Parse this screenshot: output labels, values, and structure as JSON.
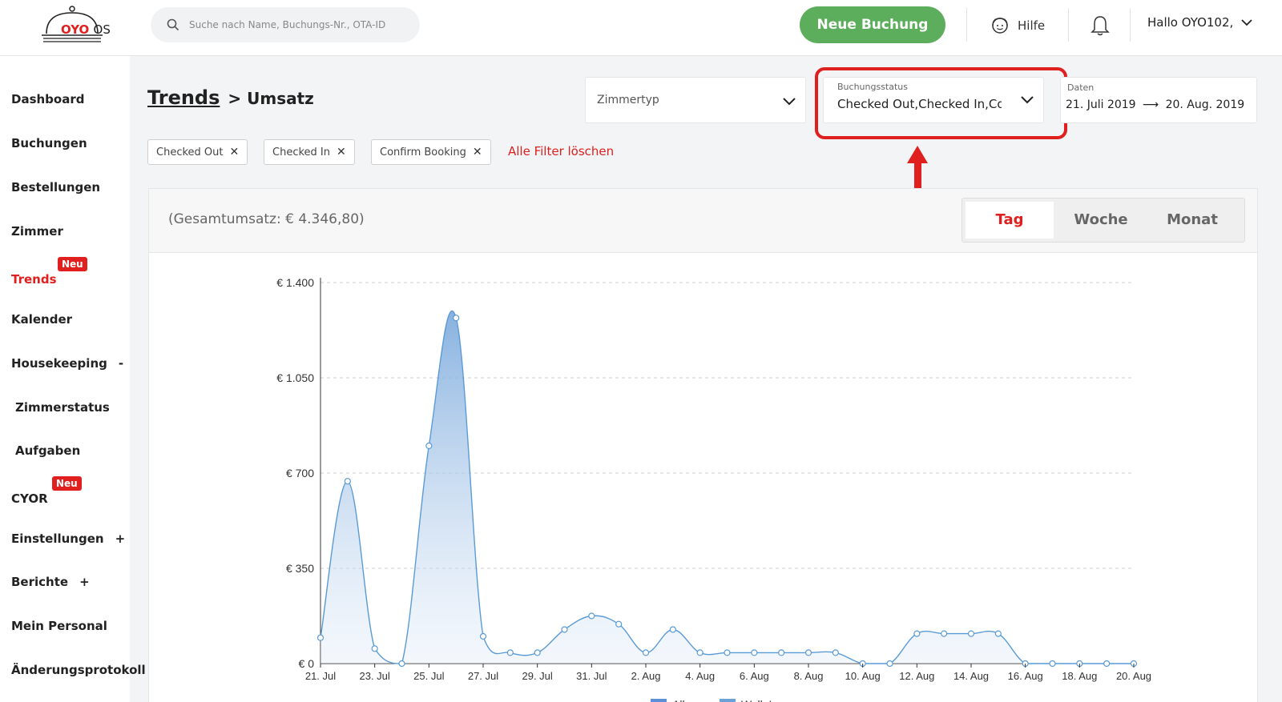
{
  "header": {
    "logo": {
      "brand": "OYO",
      "suffix": "OS"
    },
    "search": {
      "placeholder": "Suche nach Name, Buchungs-Nr., OTA-ID"
    },
    "new_booking": "Neue Buchung",
    "help": "Hilfe",
    "user_greeting": "Hallo OYO102,"
  },
  "sidebar": {
    "items": [
      {
        "label": "Dashboard"
      },
      {
        "label": "Buchungen"
      },
      {
        "label": "Bestellungen"
      },
      {
        "label": "Zimmer"
      },
      {
        "label": "Trends",
        "badge": "Neu",
        "active": true
      },
      {
        "label": "Kalender"
      },
      {
        "label": "Housekeeping",
        "suffix": "-"
      },
      {
        "label": "Zimmerstatus",
        "sub": true
      },
      {
        "label": "Aufgaben",
        "sub": true
      },
      {
        "label": "CYOR",
        "badge": "Neu"
      },
      {
        "label": "Einstellungen",
        "suffix": "+"
      },
      {
        "label": "Berichte",
        "suffix": "+"
      },
      {
        "label": "Mein Personal"
      },
      {
        "label": "Änderungsprotokoll"
      }
    ]
  },
  "main": {
    "breadcrumb_link": "Trends",
    "breadcrumb_current": "> Umsatz",
    "room_type": {
      "value": "Zimmertyp"
    },
    "booking_status": {
      "label": "Buchungsstatus",
      "value": "Checked Out,Checked In,Confirm Booking"
    },
    "dates": {
      "label": "Daten",
      "from": "21. Juli 2019",
      "arrow": "⟶",
      "to": "20. Aug. 2019"
    },
    "chips": [
      "Checked Out",
      "Checked In",
      "Confirm Booking"
    ],
    "chip_close": "✕",
    "clear_all": "Alle Filter löschen",
    "total": "(Gesamtumsatz: € 4.346,80)",
    "tabs": [
      "Tag",
      "Woche",
      "Monat"
    ],
    "active_tab": "Tag"
  },
  "colors": {
    "accent": "#e0201e",
    "primary_button": "#5cae5c",
    "series_line": "#5b9bd5"
  },
  "chart_data": {
    "type": "area",
    "x": [
      "21. Jul",
      "22. Jul",
      "23. Jul",
      "24. Jul",
      "25. Jul",
      "26. Jul",
      "27. Jul",
      "28. Jul",
      "29. Jul",
      "30. Jul",
      "31. Jul",
      "1. Aug",
      "2. Aug",
      "3. Aug",
      "4. Aug",
      "5. Aug",
      "6. Aug",
      "7. Aug",
      "8. Aug",
      "9. Aug",
      "10. Aug",
      "11. Aug",
      "12. Aug",
      "13. Aug",
      "14. Aug",
      "15. Aug",
      "16. Aug",
      "17. Aug",
      "18. Aug",
      "19. Aug",
      "20. Aug"
    ],
    "x_tick_labels": [
      "21. Jul",
      "23. Jul",
      "25. Jul",
      "27. Jul",
      "29. Jul",
      "31. Jul",
      "2. Aug",
      "4. Aug",
      "6. Aug",
      "8. Aug",
      "10. Aug",
      "12. Aug",
      "14. Aug",
      "16. Aug",
      "18. Aug",
      "20. Aug"
    ],
    "series": [
      {
        "name": "All",
        "values": [
          95,
          670,
          55,
          0,
          800,
          1270,
          100,
          40,
          40,
          125,
          175,
          145,
          40,
          125,
          40,
          40,
          40,
          40,
          40,
          40,
          0,
          0,
          110,
          110,
          110,
          110,
          0,
          0,
          0,
          0,
          0
        ]
      }
    ],
    "legend": [
      "All",
      "Walk In"
    ],
    "ylim": [
      0,
      1400
    ],
    "y_ticks": [
      0,
      350,
      700,
      1050,
      1400
    ],
    "y_tick_labels": [
      "€ 0",
      "€ 350",
      "€ 700",
      "€ 1.050",
      "€ 1.400"
    ],
    "grid": true,
    "legend_position": "bottom"
  }
}
